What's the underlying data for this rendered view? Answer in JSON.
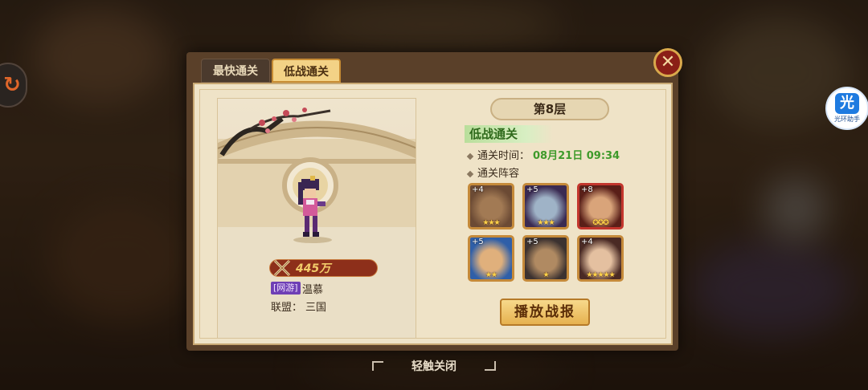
{
  "tabs": {
    "fastest_clear": "最快通关",
    "low_power_clear": "低战通关"
  },
  "close_icon": "close-icon",
  "side_button_icon": "swap-icon",
  "assistant": {
    "glyph": "光",
    "label": "光环助手"
  },
  "player": {
    "power": "445万",
    "vip_badge": "[网游]",
    "name": "温慕",
    "guild_label": "联盟：",
    "guild_value": "三国"
  },
  "floor_title": "第8层",
  "section_title": "低战通关",
  "clear_time": {
    "label": "通关时间：",
    "value": "08月21日 09:34"
  },
  "lineup_label": "通关阵容",
  "heroes": [
    {
      "level": "+4",
      "stars": "★★★",
      "colors": [
        "#6b4a34",
        "#a27a54"
      ],
      "border": "gold"
    },
    {
      "level": "+5",
      "stars": "★★★",
      "colors": [
        "#3a2a52",
        "#9fb3c7"
      ],
      "border": "gold"
    },
    {
      "level": "+8",
      "stars": "✪✪✪",
      "colors": [
        "#5a1f18",
        "#d9a47a"
      ],
      "border": "red"
    },
    {
      "level": "+5",
      "stars": "★★",
      "colors": [
        "#2f5fa8",
        "#e0b07c"
      ],
      "border": "gold"
    },
    {
      "level": "+5",
      "stars": "★",
      "colors": [
        "#3c3230",
        "#b08a62"
      ],
      "border": "gold"
    },
    {
      "level": "+4",
      "stars": "★★★★★",
      "colors": [
        "#4a2a24",
        "#e4c0a0"
      ],
      "border": "gold"
    }
  ],
  "replay_button": "播放战报",
  "tap_to_close": "轻触关闭"
}
